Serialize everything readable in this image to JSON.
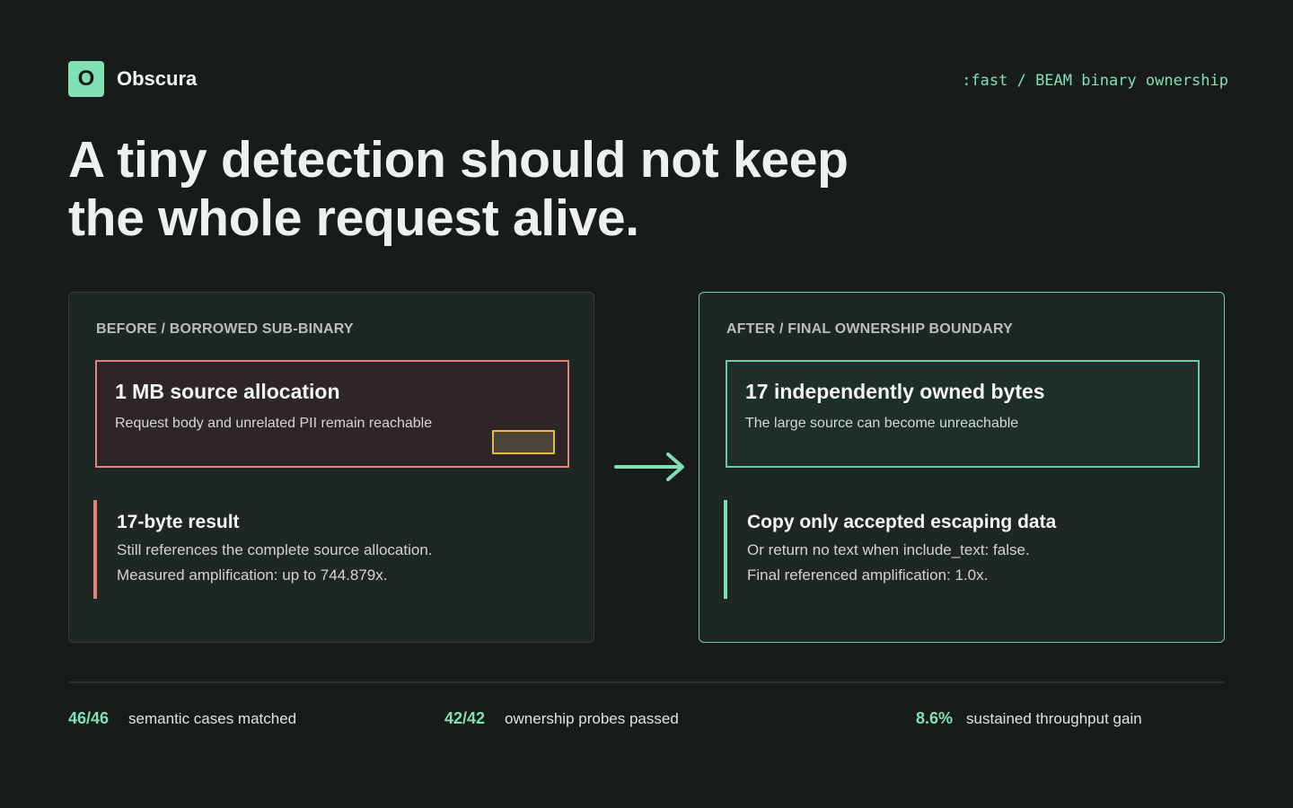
{
  "brand": {
    "logo_letter": "O",
    "name": "Obscura"
  },
  "tagline": ":fast / BEAM binary ownership",
  "headline": {
    "line1": "A tiny detection should not keep",
    "line2": "the whole request alive."
  },
  "before": {
    "label": "BEFORE / BORROWED SUB-BINARY",
    "allocation": {
      "title": "1 MB source allocation",
      "description": "Request body and unrelated PII remain reachable"
    },
    "result": {
      "title": "17-byte result",
      "line1": "Still references the complete source allocation.",
      "line2": "Measured amplification: up to 744.879x."
    }
  },
  "after": {
    "label": "AFTER / FINAL OWNERSHIP BOUNDARY",
    "allocation": {
      "title": "17 independently owned bytes",
      "description": "The large source can become unreachable"
    },
    "result": {
      "title": "Copy only accepted escaping data",
      "line1": "Or return no text when include_text: false.",
      "line2": "Final referenced amplification: 1.0x."
    }
  },
  "stats": [
    {
      "value": "46/46",
      "label": "semantic cases matched"
    },
    {
      "value": "42/42",
      "label": "ownership probes passed"
    },
    {
      "value": "8.6%",
      "label": "sustained throughput gain"
    }
  ],
  "colors": {
    "accent": "#7fe0b6",
    "danger": "#e0817b",
    "highlight": "#e6b94e",
    "background": "#171c1a"
  },
  "icons": {
    "transition": "arrow-right-icon"
  }
}
